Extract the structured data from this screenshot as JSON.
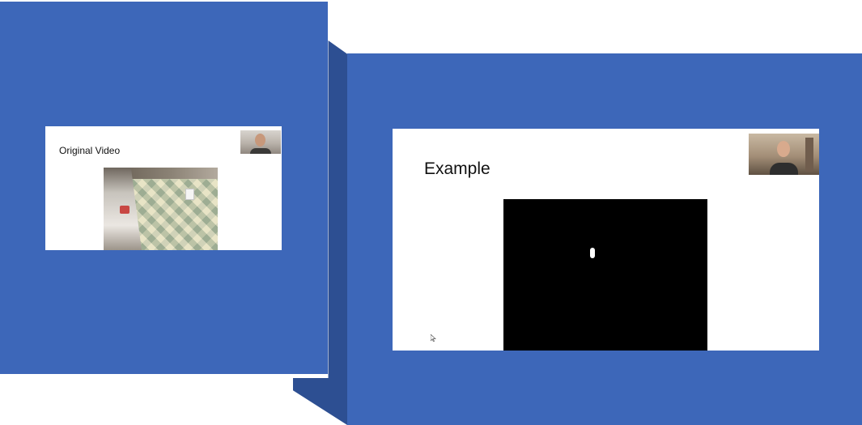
{
  "slides": {
    "left": {
      "title": "Original Video"
    },
    "right": {
      "title": "Example"
    }
  },
  "icons": {
    "cursor": "pointer-cursor-icon"
  },
  "colors": {
    "background": "#ffffff",
    "panel_blue": "#3d67b9",
    "panel_dark_blue": "#2d4f92",
    "slide_background": "#ffffff",
    "mask_background": "#000000"
  }
}
